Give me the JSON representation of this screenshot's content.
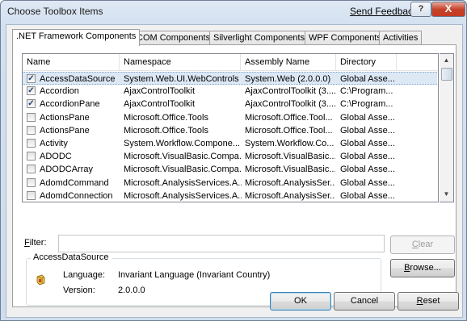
{
  "window": {
    "title": "Choose Toolbox Items",
    "send_feedback": "Send Feedback",
    "help_glyph": "?",
    "close_glyph": "X"
  },
  "tabs": [
    {
      "label": ".NET Framework Components",
      "active": true
    },
    {
      "label": "COM Components",
      "active": false
    },
    {
      "label": "Silverlight Components",
      "active": false
    },
    {
      "label": "WPF Components",
      "active": false
    },
    {
      "label": "Activities",
      "active": false
    }
  ],
  "list": {
    "columns": [
      "Name",
      "Namespace",
      "Assembly Name",
      "Directory"
    ],
    "rows": [
      {
        "checked": true,
        "name": "AccessDataSource",
        "namespace": "System.Web.UI.WebControls",
        "assembly": "System.Web (2.0.0.0)",
        "directory": "Global Asse...",
        "selected": true
      },
      {
        "checked": true,
        "name": "Accordion",
        "namespace": "AjaxControlToolkit",
        "assembly": "AjaxControlToolkit (3....",
        "directory": "C:\\Program...",
        "selected": false
      },
      {
        "checked": true,
        "name": "AccordionPane",
        "namespace": "AjaxControlToolkit",
        "assembly": "AjaxControlToolkit (3....",
        "directory": "C:\\Program...",
        "selected": false
      },
      {
        "checked": false,
        "name": "ActionsPane",
        "namespace": "Microsoft.Office.Tools",
        "assembly": "Microsoft.Office.Tool...",
        "directory": "Global Asse...",
        "selected": false
      },
      {
        "checked": false,
        "name": "ActionsPane",
        "namespace": "Microsoft.Office.Tools",
        "assembly": "Microsoft.Office.Tool...",
        "directory": "Global Asse...",
        "selected": false
      },
      {
        "checked": false,
        "name": "Activity",
        "namespace": "System.Workflow.Compone...",
        "assembly": "System.Workflow.Co...",
        "directory": "Global Asse...",
        "selected": false
      },
      {
        "checked": false,
        "name": "ADODC",
        "namespace": "Microsoft.VisualBasic.Compa...",
        "assembly": "Microsoft.VisualBasic....",
        "directory": "Global Asse...",
        "selected": false
      },
      {
        "checked": false,
        "name": "ADODCArray",
        "namespace": "Microsoft.VisualBasic.Compa...",
        "assembly": "Microsoft.VisualBasic....",
        "directory": "Global Asse...",
        "selected": false
      },
      {
        "checked": false,
        "name": "AdomdCommand",
        "namespace": "Microsoft.AnalysisServices.A...",
        "assembly": "Microsoft.AnalysisSer...",
        "directory": "Global Asse...",
        "selected": false
      },
      {
        "checked": false,
        "name": "AdomdConnection",
        "namespace": "Microsoft.AnalysisServices.A...",
        "assembly": "Microsoft.AnalysisSer...",
        "directory": "Global Asse...",
        "selected": false
      }
    ]
  },
  "filter": {
    "label": "Filter:",
    "value": ""
  },
  "buttons": {
    "clear": "Clear",
    "browse": "Browse...",
    "ok": "OK",
    "cancel": "Cancel",
    "reset": "Reset"
  },
  "details": {
    "title": "AccessDataSource",
    "language_label": "Language:",
    "language_value": "Invariant Language (Invariant Country)",
    "version_label": "Version:",
    "version_value": "2.0.0.0"
  },
  "colors": {
    "selection": "#dde8f5",
    "title_gradient": "#dfe9f5",
    "close_button": "#c5432a"
  }
}
